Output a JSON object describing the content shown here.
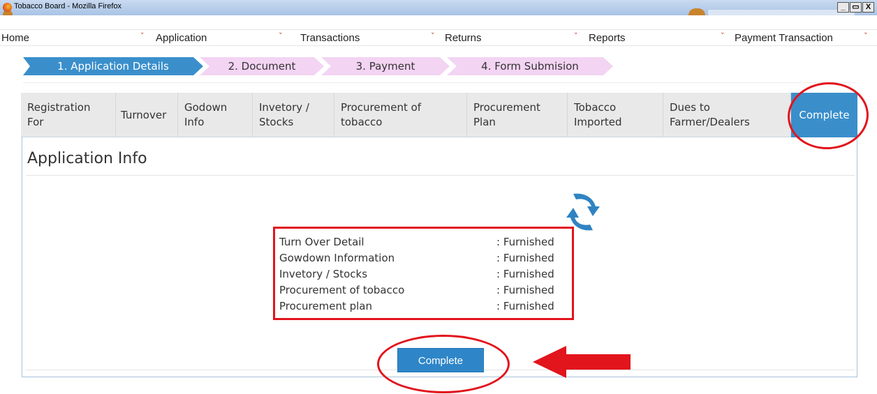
{
  "window": {
    "title": "Tobacco Board - Mozilla Firefox",
    "controls": {
      "minimize": "_",
      "maximize": "²",
      "close": "X"
    }
  },
  "menu": [
    {
      "label": "Home",
      "chevron": "˅"
    },
    {
      "label": "Application",
      "chevron": "˅"
    },
    {
      "label": "Transactions",
      "chevron": "˅"
    },
    {
      "label": "Returns",
      "chevron": "˅"
    },
    {
      "label": "Reports",
      "chevron": "˅"
    },
    {
      "label": "Payment Transaction",
      "chevron": "˅"
    }
  ],
  "steps": [
    {
      "label": "1. Application Details",
      "state": "active"
    },
    {
      "label": "2. Document",
      "state": "todo"
    },
    {
      "label": "3. Payment",
      "state": "todo"
    },
    {
      "label": "4. Form Submision",
      "state": "todo"
    }
  ],
  "tabs": [
    {
      "line1": "Registration",
      "line2": "For"
    },
    {
      "line1": "Turnover",
      "line2": ""
    },
    {
      "line1": "Godown",
      "line2": "Info"
    },
    {
      "line1": "Invetory /",
      "line2": "Stocks"
    },
    {
      "line1": "Procurement of",
      "line2": "tobacco"
    },
    {
      "line1": "Procurement",
      "line2": "Plan"
    },
    {
      "line1": "Tobacco",
      "line2": "Imported"
    },
    {
      "line1": "Dues to",
      "line2": "Farmer/Dealers"
    },
    {
      "line1": "Complete",
      "line2": "",
      "active": true
    }
  ],
  "panel": {
    "title": "Application Info",
    "refresh_icon": "refresh-icon",
    "status_items": [
      {
        "label": "Turn Over Detail",
        "value": ": Furnished"
      },
      {
        "label": "Gowdown Information",
        "value": ": Furnished"
      },
      {
        "label": "Invetory / Stocks",
        "value": ": Furnished"
      },
      {
        "label": "Procurement of tobacco",
        "value": ": Furnished"
      },
      {
        "label": "Procurement plan",
        "value": ": Furnished"
      }
    ],
    "complete_button": "Complete"
  },
  "colors": {
    "primary_blue": "#3a8fcb",
    "step_pending": "#f3d4f3",
    "annotation_red": "#e2141c",
    "tab_gray": "#e9e9e9"
  }
}
